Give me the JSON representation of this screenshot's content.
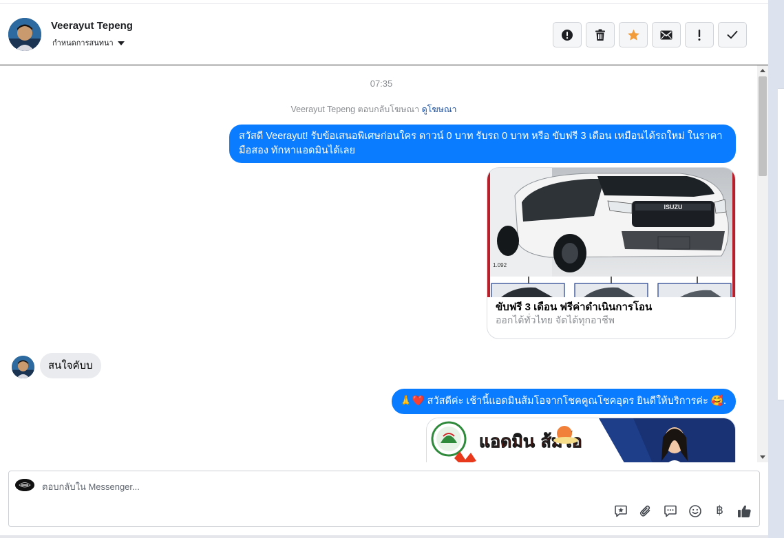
{
  "header": {
    "contact_name": "Veerayut Tepeng",
    "assign_label": "กำหนดการสนทนา",
    "toolbar": [
      {
        "id": "spam",
        "icon": "alert-circle-icon"
      },
      {
        "id": "delete",
        "icon": "trash-icon"
      },
      {
        "id": "star",
        "icon": "star-icon"
      },
      {
        "id": "unread",
        "icon": "envelope-icon"
      },
      {
        "id": "follow-up",
        "icon": "exclamation-icon"
      },
      {
        "id": "done",
        "icon": "checkmark-icon"
      }
    ]
  },
  "chat": {
    "timestamp": "07:35",
    "ad_reply_note": "Veerayut Tepeng ตอบกลับโฆษณา",
    "ad_reply_link": "ดูโฆษณา",
    "messages": [
      {
        "from": "page",
        "text": "สวัสดี Veerayut! รับข้อเสนอพิเศษก่อนใคร ดาวน์ 0 บาท รับรถ 0 บาท หรือ ขับฟรี 3 เดือน เหมือนได้รถใหม่ ในราคามือสอง ทักหาแอดมินได้เลย"
      },
      {
        "from": "page",
        "type": "ad-card",
        "title": "ขับฟรี 3 เดือน ฟรีค่าดำเนินการโอน",
        "description": "ออกได้ทั่วไทย จัดได้ทุกอาชีพ",
        "image_icon": "pickup-truck-image",
        "brand": "ISUZU",
        "plate_caption": "1.092"
      },
      {
        "from": "user",
        "text": "สนใจคับบ"
      },
      {
        "from": "page",
        "text": "สวัสดีค่ะ เช้านี้แอดมินส้มโอจากโชคคูณโชคอุดร ยินดีให้บริการค่ะ",
        "prefix_emoji": "🙏❤️",
        "suffix_emoji": "🥰."
      },
      {
        "from": "page",
        "type": "image",
        "image_icon": "admin-banner-image",
        "banner_text": "แอดมิน ส้มโอ"
      }
    ]
  },
  "composer": {
    "placeholder": "ตอบกลับใน Messenger...",
    "tools": [
      "saved-reply-icon",
      "paperclip-icon",
      "chat-bubble-icon",
      "emoji-icon",
      "baht-icon",
      "thumbs-up-icon"
    ],
    "baht_symbol": "฿"
  },
  "colors": {
    "outgoing_bubble": "#0a7cff",
    "incoming_bubble": "#e9ebee",
    "star": "#f19b39",
    "muted_text": "#8a8d91"
  }
}
